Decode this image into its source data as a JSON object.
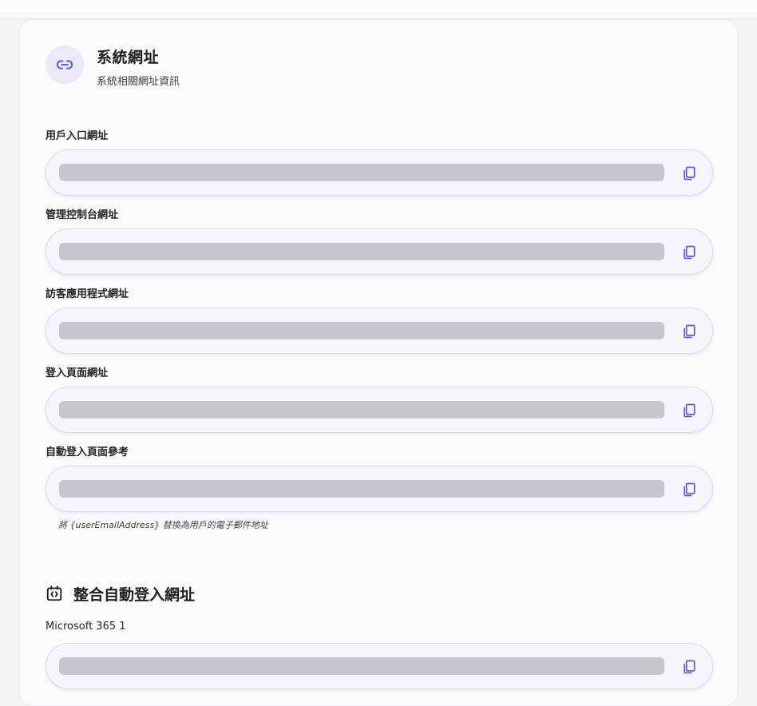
{
  "header": {
    "title": "系統網址",
    "subtitle": "系統相關網址資訊",
    "icon": "link-icon"
  },
  "fields": [
    {
      "label": "用戶入口網址",
      "value": ""
    },
    {
      "label": "管理控制台網址",
      "value": ""
    },
    {
      "label": "訪客應用程式網址",
      "value": ""
    },
    {
      "label": "登入頁面網址",
      "value": ""
    },
    {
      "label": "自動登入頁面參考",
      "value": ""
    }
  ],
  "hint": "將 {userEmailAddress} 替換為用戶的電子郵件地址",
  "integration": {
    "title": "整合自動登入網址",
    "icon": "code-calendar-icon",
    "items": [
      {
        "label": "Microsoft 365 1",
        "value": ""
      }
    ]
  },
  "colors": {
    "accent": "#5b5bd6",
    "placeholder": "#c7c6cb",
    "icon_bg": "#ebe9f7"
  }
}
